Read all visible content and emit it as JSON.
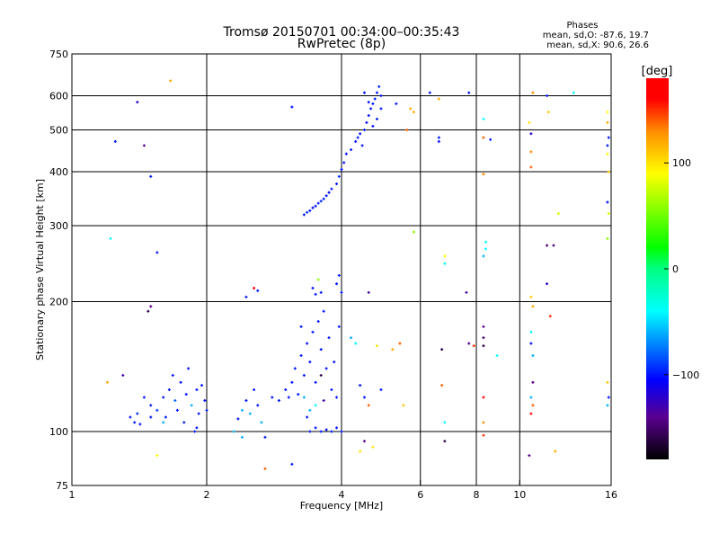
{
  "chart_data": {
    "type": "scatter",
    "title": "Tromsø 20150701 00:34:00–00:35:43",
    "subtitle": "RwPretec (8p)",
    "xlabel": "Frequency [MHz]",
    "ylabel": "Stationary phase Virtual Height [km]",
    "xscale": "log",
    "yscale": "log",
    "xlim": [
      1,
      16
    ],
    "ylim": [
      75,
      750
    ],
    "xticks": [
      1,
      2,
      4,
      6,
      8,
      10,
      16
    ],
    "yticks": [
      75,
      100,
      200,
      300,
      400,
      500,
      600,
      750
    ],
    "xgrid": [
      2,
      4,
      6,
      8,
      10
    ],
    "ygrid": [
      100,
      200,
      300,
      400,
      500,
      600
    ],
    "grid": true,
    "stats": {
      "heading": "Phases",
      "o_line": "mean, sd,O:  -87.6, 19.7",
      "x_line": "mean, sd,X:  90.6, 26.6"
    },
    "colorbar": {
      "label": "[deg]",
      "range": [
        -180,
        180
      ],
      "ticks": [
        100,
        0,
        -100
      ],
      "tick_labels": [
        "100",
        "0",
        "−100"
      ],
      "stops": [
        {
          "v": -180,
          "c": "#000000"
        },
        {
          "v": -140,
          "c": "#5a0090"
        },
        {
          "v": -105,
          "c": "#0000ff"
        },
        {
          "v": -40,
          "c": "#00ffff"
        },
        {
          "v": 0,
          "c": "#00ff80"
        },
        {
          "v": 20,
          "c": "#00ff00"
        },
        {
          "v": 90,
          "c": "#ffff00"
        },
        {
          "v": 130,
          "c": "#ff8c00"
        },
        {
          "v": 160,
          "c": "#ff0000"
        },
        {
          "v": 180,
          "c": "#ff0000"
        }
      ]
    },
    "point_fields": [
      "frequency_mhz",
      "height_km",
      "phase_deg"
    ],
    "points": [
      [
        3.3,
        318,
        -100
      ],
      [
        3.35,
        322,
        -95
      ],
      [
        3.4,
        325,
        -100
      ],
      [
        3.45,
        330,
        -105
      ],
      [
        3.5,
        333,
        -100
      ],
      [
        3.55,
        338,
        -100
      ],
      [
        3.6,
        342,
        -95
      ],
      [
        3.65,
        346,
        -100
      ],
      [
        3.7,
        352,
        -100
      ],
      [
        3.75,
        358,
        -105
      ],
      [
        3.8,
        365,
        -100
      ],
      [
        3.9,
        375,
        -100
      ],
      [
        3.95,
        390,
        -95
      ],
      [
        4.0,
        405,
        -100
      ],
      [
        4.05,
        420,
        -100
      ],
      [
        4.1,
        440,
        -100
      ],
      [
        4.2,
        450,
        -100
      ],
      [
        4.3,
        470,
        -100
      ],
      [
        4.4,
        490,
        -100
      ],
      [
        4.5,
        500,
        -100
      ],
      [
        4.55,
        520,
        -105
      ],
      [
        4.6,
        540,
        -100
      ],
      [
        4.65,
        560,
        -100
      ],
      [
        4.7,
        575,
        -100
      ],
      [
        4.75,
        590,
        -100
      ],
      [
        4.8,
        610,
        -100
      ],
      [
        4.85,
        630,
        -95
      ],
      [
        4.9,
        600,
        -100
      ],
      [
        4.45,
        460,
        -100
      ],
      [
        4.35,
        480,
        -100
      ],
      [
        4.7,
        510,
        -100
      ],
      [
        4.6,
        580,
        -100
      ],
      [
        4.5,
        610,
        -100
      ],
      [
        4.9,
        560,
        -100
      ],
      [
        4.8,
        530,
        -100
      ],
      [
        1.35,
        108,
        -100
      ],
      [
        1.38,
        105,
        -100
      ],
      [
        1.4,
        110,
        -95
      ],
      [
        1.42,
        104,
        -100
      ],
      [
        1.5,
        115,
        -100
      ],
      [
        1.55,
        112,
        -90
      ],
      [
        1.6,
        120,
        -100
      ],
      [
        1.62,
        108,
        -100
      ],
      [
        1.65,
        125,
        -100
      ],
      [
        1.7,
        118,
        -80
      ],
      [
        1.72,
        112,
        -100
      ],
      [
        1.75,
        130,
        -100
      ],
      [
        1.78,
        105,
        -100
      ],
      [
        1.8,
        122,
        -100
      ],
      [
        1.85,
        115,
        -60
      ],
      [
        1.88,
        100,
        -100
      ],
      [
        1.9,
        102,
        -100
      ],
      [
        1.92,
        110,
        -100
      ],
      [
        1.95,
        128,
        -100
      ],
      [
        1.98,
        118,
        -100
      ],
      [
        2.0,
        112,
        -100
      ],
      [
        1.6,
        105,
        -60
      ],
      [
        1.68,
        135,
        -100
      ],
      [
        1.45,
        120,
        -100
      ],
      [
        1.82,
        140,
        -100
      ],
      [
        1.9,
        125,
        -100
      ],
      [
        1.5,
        108,
        -100
      ],
      [
        2.3,
        100,
        -60
      ],
      [
        2.35,
        107,
        -100
      ],
      [
        2.4,
        112,
        -60
      ],
      [
        2.45,
        118,
        -100
      ],
      [
        2.5,
        110,
        -60
      ],
      [
        2.55,
        125,
        -100
      ],
      [
        2.6,
        115,
        -100
      ],
      [
        2.65,
        105,
        -60
      ],
      [
        2.7,
        97,
        -100
      ],
      [
        2.8,
        120,
        -100
      ],
      [
        2.9,
        118,
        -100
      ],
      [
        2.4,
        97,
        -60
      ],
      [
        2.45,
        205,
        -100
      ],
      [
        2.55,
        215,
        160
      ],
      [
        2.6,
        212,
        -100
      ],
      [
        3.0,
        125,
        -100
      ],
      [
        3.05,
        120,
        -100
      ],
      [
        3.1,
        130,
        -100
      ],
      [
        3.15,
        140,
        -100
      ],
      [
        3.2,
        122,
        -100
      ],
      [
        3.25,
        150,
        -100
      ],
      [
        3.3,
        135,
        -100
      ],
      [
        3.35,
        160,
        -100
      ],
      [
        3.4,
        145,
        -100
      ],
      [
        3.45,
        170,
        -100
      ],
      [
        3.5,
        130,
        -100
      ],
      [
        3.55,
        180,
        -100
      ],
      [
        3.6,
        155,
        -100
      ],
      [
        3.65,
        190,
        -100
      ],
      [
        3.7,
        140,
        -100
      ],
      [
        3.75,
        165,
        -100
      ],
      [
        3.8,
        125,
        -100
      ],
      [
        3.85,
        145,
        -100
      ],
      [
        3.9,
        120,
        -100
      ],
      [
        3.95,
        175,
        -100
      ],
      [
        3.4,
        100,
        -100
      ],
      [
        3.5,
        102,
        -100
      ],
      [
        3.6,
        100,
        -100
      ],
      [
        3.7,
        101,
        -100
      ],
      [
        3.8,
        100,
        -100
      ],
      [
        3.9,
        102,
        -100
      ],
      [
        4.0,
        100,
        -100
      ],
      [
        3.45,
        215,
        -100
      ],
      [
        3.5,
        208,
        -100
      ],
      [
        3.55,
        225,
        60
      ],
      [
        3.6,
        210,
        -100
      ],
      [
        3.9,
        220,
        -100
      ],
      [
        3.95,
        230,
        -100
      ],
      [
        4.0,
        210,
        -100
      ],
      [
        3.3,
        120,
        -60
      ],
      [
        3.4,
        112,
        -60
      ],
      [
        3.6,
        135,
        -160
      ],
      [
        3.5,
        115,
        -40
      ],
      [
        3.35,
        108,
        -100
      ],
      [
        3.65,
        118,
        -130
      ],
      [
        3.25,
        175,
        -100
      ],
      [
        4.2,
        165,
        -60
      ],
      [
        4.3,
        160,
        -40
      ],
      [
        4.4,
        128,
        -100
      ],
      [
        4.5,
        120,
        -100
      ],
      [
        4.6,
        115,
        140
      ],
      [
        4.8,
        158,
        100
      ],
      [
        4.9,
        125,
        -100
      ],
      [
        5.2,
        155,
        120
      ],
      [
        5.4,
        160,
        140
      ],
      [
        5.5,
        115,
        110
      ],
      [
        4.5,
        95,
        -140
      ],
      [
        4.7,
        92,
        100
      ],
      [
        4.4,
        90,
        100
      ],
      [
        4.6,
        210,
        -130
      ],
      [
        1.25,
        470,
        -100
      ],
      [
        1.4,
        580,
        -120
      ],
      [
        1.45,
        460,
        -140
      ],
      [
        1.5,
        390,
        -100
      ],
      [
        1.55,
        260,
        -100
      ],
      [
        1.22,
        280,
        -40
      ],
      [
        1.5,
        195,
        -140
      ],
      [
        1.48,
        190,
        -160
      ],
      [
        1.66,
        650,
        120
      ],
      [
        1.3,
        135,
        -130
      ],
      [
        1.2,
        130,
        120
      ],
      [
        1.55,
        88,
        90
      ],
      [
        2.7,
        82,
        140
      ],
      [
        3.1,
        84,
        -100
      ],
      [
        3.1,
        565,
        -100
      ],
      [
        5.3,
        575,
        -100
      ],
      [
        5.7,
        560,
        120
      ],
      [
        5.8,
        290,
        60
      ],
      [
        6.3,
        610,
        -100
      ],
      [
        6.6,
        590,
        120
      ],
      [
        6.6,
        480,
        -100
      ],
      [
        6.6,
        470,
        -100
      ],
      [
        6.8,
        255,
        90
      ],
      [
        6.8,
        245,
        -30
      ],
      [
        6.7,
        155,
        -160
      ],
      [
        6.7,
        128,
        140
      ],
      [
        6.8,
        105,
        -40
      ],
      [
        6.8,
        95,
        -160
      ],
      [
        7.7,
        610,
        -100
      ],
      [
        7.6,
        210,
        -130
      ],
      [
        7.7,
        160,
        -140
      ],
      [
        7.9,
        158,
        150
      ],
      [
        8.3,
        120,
        160
      ],
      [
        8.3,
        480,
        140
      ],
      [
        8.6,
        475,
        -100
      ],
      [
        8.3,
        530,
        -40
      ],
      [
        8.3,
        395,
        130
      ],
      [
        8.4,
        275,
        -40
      ],
      [
        8.4,
        265,
        -40
      ],
      [
        8.3,
        255,
        -60
      ],
      [
        8.3,
        175,
        -140
      ],
      [
        8.3,
        165,
        -150
      ],
      [
        8.3,
        158,
        -160
      ],
      [
        8.3,
        105,
        130
      ],
      [
        8.3,
        98,
        150
      ],
      [
        8.9,
        150,
        -40
      ],
      [
        10.7,
        610,
        130
      ],
      [
        10.5,
        520,
        100
      ],
      [
        10.6,
        490,
        -120
      ],
      [
        10.6,
        445,
        130
      ],
      [
        10.6,
        410,
        140
      ],
      [
        11.5,
        600,
        -100
      ],
      [
        11.6,
        550,
        110
      ],
      [
        12.2,
        320,
        80
      ],
      [
        11.5,
        270,
        -150
      ],
      [
        11.9,
        270,
        -150
      ],
      [
        11.5,
        220,
        -120
      ],
      [
        10.6,
        205,
        110
      ],
      [
        10.7,
        195,
        120
      ],
      [
        11.7,
        185,
        150
      ],
      [
        10.6,
        170,
        -40
      ],
      [
        10.6,
        160,
        -100
      ],
      [
        10.7,
        150,
        -60
      ],
      [
        10.7,
        130,
        -140
      ],
      [
        10.6,
        120,
        -60
      ],
      [
        10.7,
        115,
        140
      ],
      [
        10.6,
        110,
        160
      ],
      [
        10.5,
        88,
        -140
      ],
      [
        12.0,
        90,
        120
      ],
      [
        13.2,
        610,
        -40
      ],
      [
        15.7,
        550,
        90
      ],
      [
        15.7,
        520,
        120
      ],
      [
        15.8,
        480,
        -100
      ],
      [
        15.7,
        460,
        -100
      ],
      [
        15.7,
        440,
        90
      ],
      [
        15.8,
        400,
        110
      ],
      [
        15.7,
        340,
        -100
      ],
      [
        15.8,
        320,
        80
      ],
      [
        15.7,
        280,
        60
      ],
      [
        15.7,
        130,
        110
      ],
      [
        15.8,
        120,
        -100
      ],
      [
        15.7,
        115,
        -60
      ],
      [
        5.6,
        500,
        140
      ],
      [
        5.8,
        550,
        120
      ]
    ]
  }
}
